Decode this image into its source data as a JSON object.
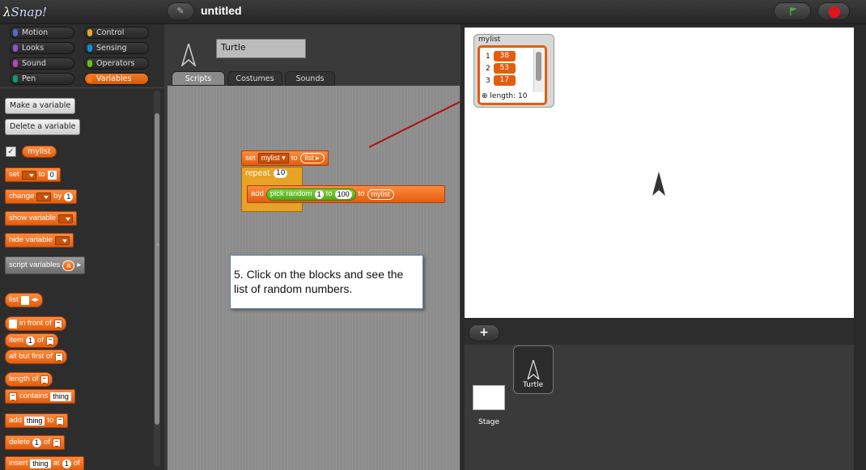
{
  "app": {
    "logo": "Snap!",
    "project_title": "untitled"
  },
  "categories": [
    {
      "label": "Motion",
      "color": "#4a6cd4"
    },
    {
      "label": "Control",
      "color": "#e6a822"
    },
    {
      "label": "Looks",
      "color": "#8a55d7"
    },
    {
      "label": "Sensing",
      "color": "#0494dc"
    },
    {
      "label": "Sound",
      "color": "#bb42c3"
    },
    {
      "label": "Operators",
      "color": "#62c213"
    },
    {
      "label": "Pen",
      "color": "#00a178"
    },
    {
      "label": "Variables",
      "color": "#f3761d"
    }
  ],
  "palette": {
    "make_variable": "Make a variable",
    "delete_variable": "Delete a variable",
    "var_name": "mylist",
    "set": {
      "label": "set",
      "to": "to",
      "value": "0"
    },
    "change": {
      "label": "change",
      "by": "by",
      "value": "1"
    },
    "show_variable": "show variable",
    "hide_variable": "hide variable",
    "script_variables": {
      "label": "script variables",
      "arg": "a"
    },
    "list": "list",
    "in_front_of": "in front of",
    "item": {
      "label": "item",
      "value": "1",
      "of": "of"
    },
    "all_but_first": "all but first of",
    "length_of": "length of",
    "contains": {
      "label": "contains",
      "value": "thing"
    },
    "add": {
      "label": "add",
      "value": "thing",
      "to": "to"
    },
    "delete": {
      "label": "delete",
      "value": "1",
      "of": "of"
    },
    "insert": {
      "label": "insert",
      "value": "thing",
      "at": "at",
      "idx": "1",
      "of": "of"
    }
  },
  "editor": {
    "sprite_name": "Turtle",
    "tabs": [
      "Scripts",
      "Costumes",
      "Sounds"
    ]
  },
  "script": {
    "set": {
      "label": "set",
      "var": "mylist",
      "to": "to",
      "list": "list"
    },
    "repeat": {
      "label": "repeat",
      "count": "10"
    },
    "add": {
      "label": "add",
      "pick": "pick random",
      "from": "1",
      "to_word": "to",
      "max": "100",
      "to2": "to",
      "target": "mylist"
    }
  },
  "tip": "5. Click on the blocks and see the list of random numbers.",
  "watcher": {
    "title": "mylist",
    "rows": [
      {
        "index": "1",
        "value": "38"
      },
      {
        "index": "2",
        "value": "53"
      },
      {
        "index": "3",
        "value": "17"
      }
    ],
    "length_label": "length: 10"
  },
  "corral": {
    "stage_label": "Stage",
    "sprite_label": "Turtle",
    "add_label": "+"
  }
}
